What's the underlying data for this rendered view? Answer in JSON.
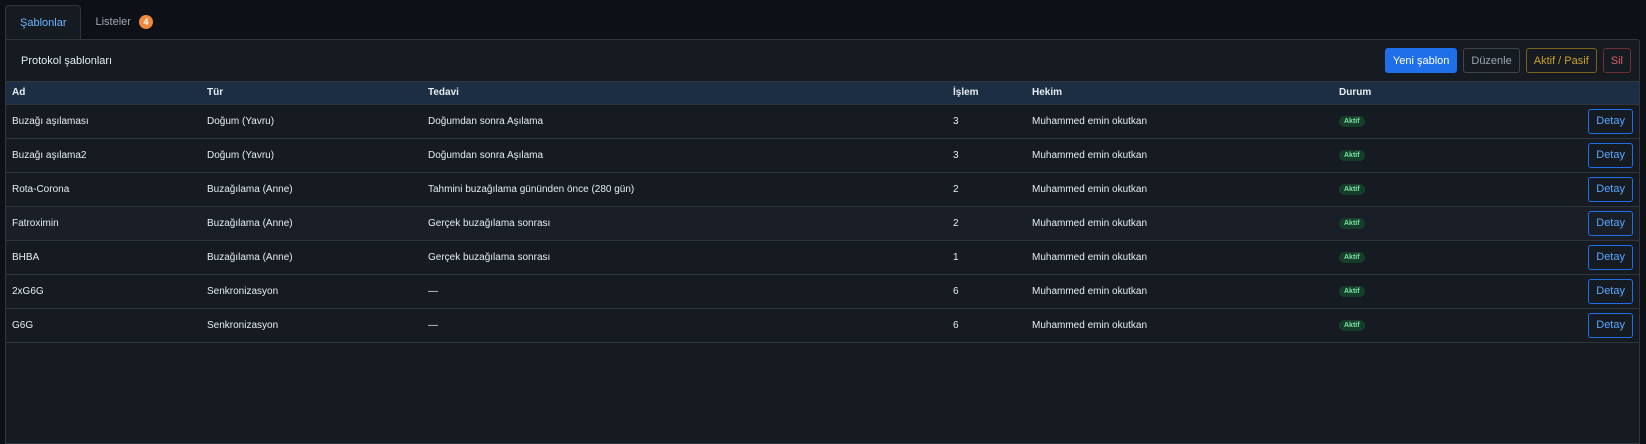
{
  "tabs": [
    {
      "label": "Şablonlar",
      "active": true
    },
    {
      "label": "Listeler",
      "badge": "4"
    }
  ],
  "panel": {
    "title": "Protokol şablonları",
    "actions": {
      "new": "Yeni şablon",
      "edit": "Düzenle",
      "toggle": "Aktif / Pasif",
      "delete": "Sil"
    }
  },
  "table": {
    "columns": [
      "Ad",
      "Tür",
      "Tedavi",
      "İşlem",
      "Hekim",
      "Durum"
    ],
    "rows": [
      {
        "ad": "Buzağı aşılaması",
        "tur": "Doğum (Yavru)",
        "tedavi": "Doğumdan sonra Aşılama",
        "islem": "3",
        "hekim": "Muhammed emin okutkan",
        "durum": "Aktif",
        "action": "Detay"
      },
      {
        "ad": "Buzağı aşılama2",
        "tur": "Doğum (Yavru)",
        "tedavi": "Doğumdan sonra Aşılama",
        "islem": "3",
        "hekim": "Muhammed emin okutkan",
        "durum": "Aktif",
        "action": "Detay"
      },
      {
        "ad": "Rota-Corona",
        "tur": "Buzağılama (Anne)",
        "tedavi": "Tahmini buzağılama gününden önce (280 gün)",
        "islem": "2",
        "hekim": "Muhammed emin okutkan",
        "durum": "Aktif",
        "action": "Detay"
      },
      {
        "ad": "Fatroximin",
        "tur": "Buzağılama (Anne)",
        "tedavi": "Gerçek buzağılama sonrası",
        "islem": "2",
        "hekim": "Muhammed emin okutkan",
        "durum": "Aktif",
        "action": "Detay"
      },
      {
        "ad": "BHBA",
        "tur": "Buzağılama (Anne)",
        "tedavi": "Gerçek buzağılama sonrası",
        "islem": "1",
        "hekim": "Muhammed emin okutkan",
        "durum": "Aktif",
        "action": "Detay"
      },
      {
        "ad": "2xG6G",
        "tur": "Senkronizasyon",
        "tedavi": "—",
        "islem": "6",
        "hekim": "Muhammed emin okutkan",
        "durum": "Aktif",
        "action": "Detay"
      },
      {
        "ad": "G6G",
        "tur": "Senkronizasyon",
        "tedavi": "—",
        "islem": "6",
        "hekim": "Muhammed emin okutkan",
        "durum": "Aktif",
        "action": "Detay"
      }
    ]
  },
  "colors": {
    "accent": "#1f6feb",
    "badge": "#f0883e",
    "status_active": "#7ee2a8"
  }
}
